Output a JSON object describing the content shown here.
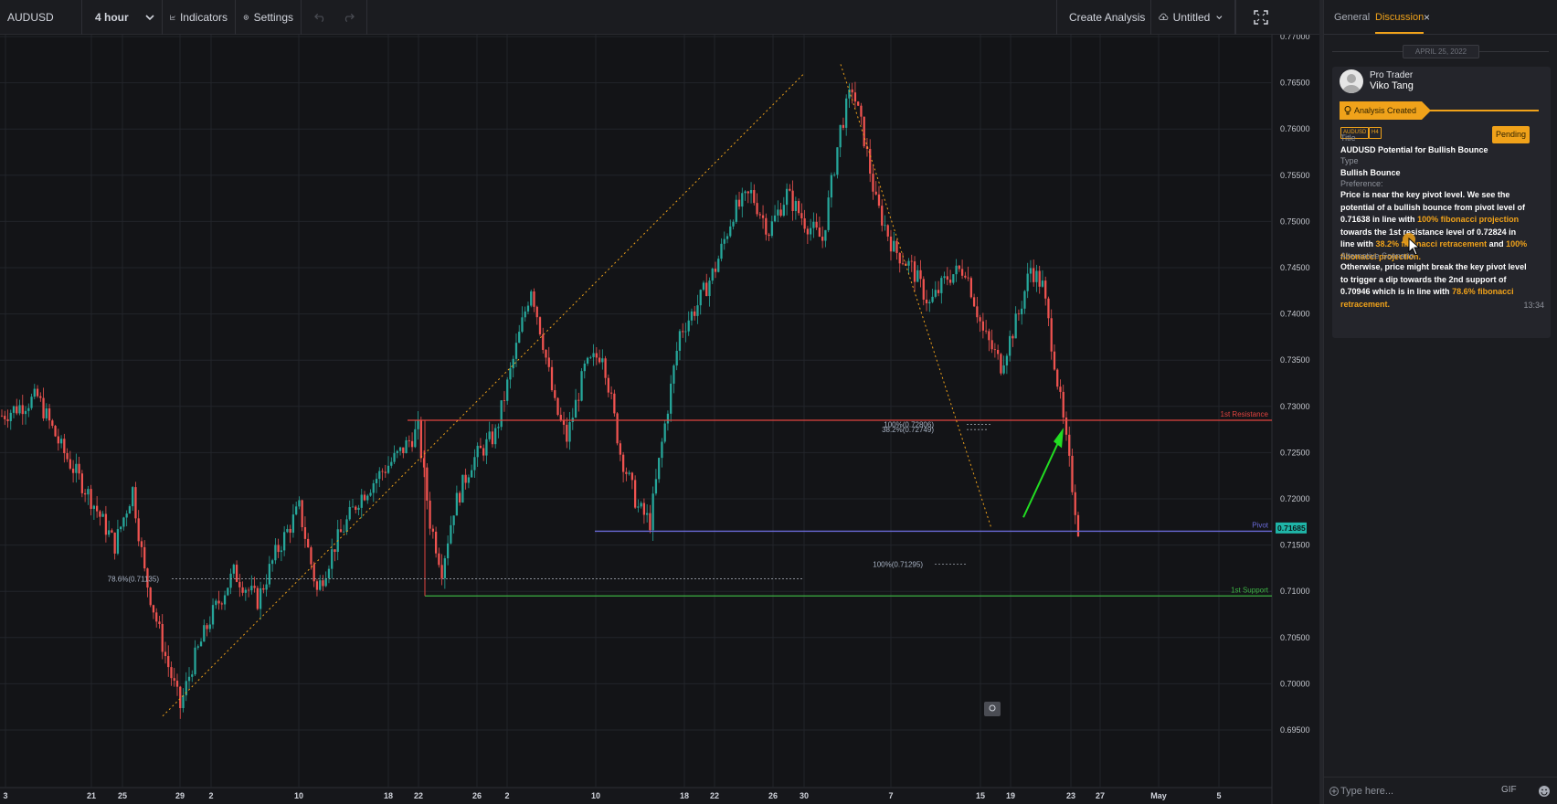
{
  "toolbar": {
    "symbol": "AUDUSD",
    "interval": "4 hour",
    "indicators_label": "Indicators",
    "settings_label": "Settings",
    "create_analysis_label": "Create Analysis",
    "layout_name": "Untitled"
  },
  "chart_data": {
    "type": "candlestick",
    "symbol": "AUDUSD",
    "ylim": [
      0.695,
      0.77
    ],
    "y_ticks": [
      "0.77000",
      "0.76500",
      "0.76000",
      "0.75500",
      "0.75000",
      "0.74500",
      "0.74000",
      "0.73500",
      "0.73000",
      "0.72500",
      "0.72000",
      "0.71500",
      "0.71000",
      "0.70500",
      "0.70000",
      "0.69500"
    ],
    "x_ticks": [
      "3",
      "21",
      "25",
      "29",
      "2",
      "10",
      "18",
      "22",
      "26",
      "2",
      "10",
      "18",
      "22",
      "26",
      "30",
      "7",
      "15",
      "19",
      "23",
      "27",
      "May",
      "5"
    ],
    "price_label": "0.71685",
    "levels": [
      {
        "name": "1st Resistance",
        "value": 0.7285,
        "color": "#e0433f"
      },
      {
        "name": "Pivot",
        "value": 0.7165,
        "color": "#6a6ad8"
      },
      {
        "name": "1st Support",
        "value": 0.7095,
        "color": "#3cb043"
      }
    ],
    "fib_labels": [
      {
        "text": "100%(0.72806)",
        "value": 0.72806
      },
      {
        "text": "38.2%(0.72749)",
        "value": 0.72749
      },
      {
        "text": "100%(0.71295)",
        "value": 0.71295
      },
      {
        "text": "78.6%(0.71135)",
        "value": 0.71135
      }
    ],
    "path_points": [
      [
        0,
        0.729
      ],
      [
        12,
        0.731
      ],
      [
        20,
        0.7255
      ],
      [
        30,
        0.72
      ],
      [
        38,
        0.715
      ],
      [
        44,
        0.721
      ],
      [
        48,
        0.712
      ],
      [
        55,
        0.703
      ],
      [
        60,
        0.6975
      ],
      [
        64,
        0.702
      ],
      [
        70,
        0.707
      ],
      [
        78,
        0.712
      ],
      [
        86,
        0.709
      ],
      [
        92,
        0.714
      ],
      [
        100,
        0.719
      ],
      [
        106,
        0.71
      ],
      [
        112,
        0.715
      ],
      [
        120,
        0.72
      ],
      [
        128,
        0.723
      ],
      [
        134,
        0.725
      ],
      [
        140,
        0.7275
      ],
      [
        144,
        0.7175
      ],
      [
        148,
        0.7125
      ],
      [
        152,
        0.719
      ],
      [
        158,
        0.724
      ],
      [
        166,
        0.727
      ],
      [
        172,
        0.735
      ],
      [
        178,
        0.743
      ],
      [
        182,
        0.737
      ],
      [
        186,
        0.73
      ],
      [
        190,
        0.7265
      ],
      [
        196,
        0.734
      ],
      [
        202,
        0.736
      ],
      [
        208,
        0.725
      ],
      [
        214,
        0.719
      ],
      [
        218,
        0.7175
      ],
      [
        222,
        0.726
      ],
      [
        228,
        0.738
      ],
      [
        234,
        0.741
      ],
      [
        240,
        0.745
      ],
      [
        246,
        0.751
      ],
      [
        252,
        0.753
      ],
      [
        258,
        0.749
      ],
      [
        264,
        0.753
      ],
      [
        270,
        0.75
      ],
      [
        276,
        0.748
      ],
      [
        282,
        0.76
      ],
      [
        286,
        0.7645
      ],
      [
        290,
        0.759
      ],
      [
        294,
        0.752
      ],
      [
        300,
        0.747
      ],
      [
        306,
        0.745
      ],
      [
        312,
        0.741
      ],
      [
        318,
        0.744
      ],
      [
        324,
        0.745
      ],
      [
        330,
        0.738
      ],
      [
        336,
        0.7345
      ],
      [
        342,
        0.74
      ],
      [
        346,
        0.745
      ],
      [
        350,
        0.743
      ],
      [
        354,
        0.735
      ],
      [
        358,
        0.726
      ],
      [
        362,
        0.7168
      ]
    ]
  },
  "panel": {
    "tab_general": "General",
    "tab_discussion": "Discussion",
    "close_glyph": "×",
    "date_label": "APRIL 25, 2022",
    "role": "Pro Trader",
    "user_name": "Viko Tang",
    "banner_label": "Analysis Created",
    "tags": [
      "AUDUSD",
      "H4"
    ],
    "status": "Pending",
    "title_label": "Title",
    "title_value": "AUDUSD Potential for Bullish Bounce",
    "type_label": "Type",
    "type_value": "Bullish Bounce",
    "preference_label": "Preference:",
    "pref_1": "Price is near the key pivot level. We see the potential of a bullish bounce from pivot level of 0.71638 in line with",
    "pref_hl1": "100% fibonacci projection",
    "pref_2": "towards the 1st resistance level of 0.72824 in line with",
    "pref_hl2": "38.2% fibonacci retracement",
    "pref_3": "and",
    "pref_hl3": "100% fibonacci projection.",
    "alt_label": "Alternative Scenario:",
    "alt_1": "Otherwise, price might break the key pivot level to trigger a dip towards the 2nd support of 0.70946 which is in line with",
    "alt_hl": "78.6% fibonacci retracement.",
    "time": "13:34",
    "input_placeholder": "Type here...",
    "gif_label": "GIF"
  }
}
